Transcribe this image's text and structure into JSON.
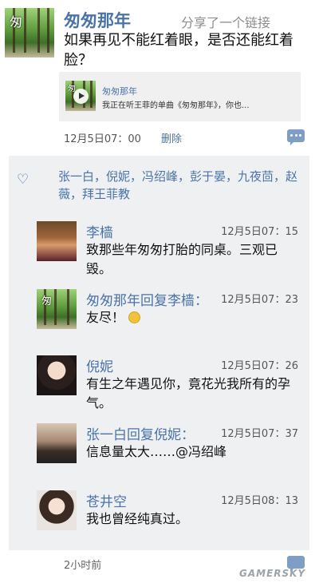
{
  "post": {
    "author": "匆匆那年",
    "action": "分享了一个链接",
    "text": "如果再见不能红着眼，是否还能红着脸？",
    "avatar_caption": "匆",
    "link": {
      "title": "匆匆那年",
      "description": "我正在听王菲的单曲《匆匆那年》，你也...",
      "thumb_caption": "匆"
    },
    "time": "12月5日07：00",
    "delete_label": "删除"
  },
  "likes": {
    "names": "张一白，倪妮，冯绍峰，彭于晏，九夜茴，赵薇，拜王菲教"
  },
  "comments": [
    {
      "name": "李樯",
      "time": "12月5日07：15",
      "text": "致那些年匆匆打胎的同桌。三观已毁。"
    },
    {
      "name": "匆匆那年回复李樯：",
      "time": "12月5日07：23",
      "text": "友尽！"
    },
    {
      "name": "倪妮",
      "time": "12月5日07：26",
      "text": "有生之年遇见你，竟花光我所有的孕气。"
    },
    {
      "name": "张一白回复倪妮：",
      "time": "12月5日07：37",
      "text": "信息量太大……@冯绍峰"
    },
    {
      "name": "苍井空",
      "time": "12月5日08：13",
      "text": "我也曾经纯真过。"
    }
  ],
  "footer": {
    "time": "2小时前",
    "watermark": "GAMERSKY"
  },
  "colors": {
    "link_blue": "#4a73a8",
    "panel_bg": "#eef0f2"
  },
  "icons": [
    "heart-icon",
    "comment-icon",
    "play-icon",
    "emoji-icon"
  ]
}
